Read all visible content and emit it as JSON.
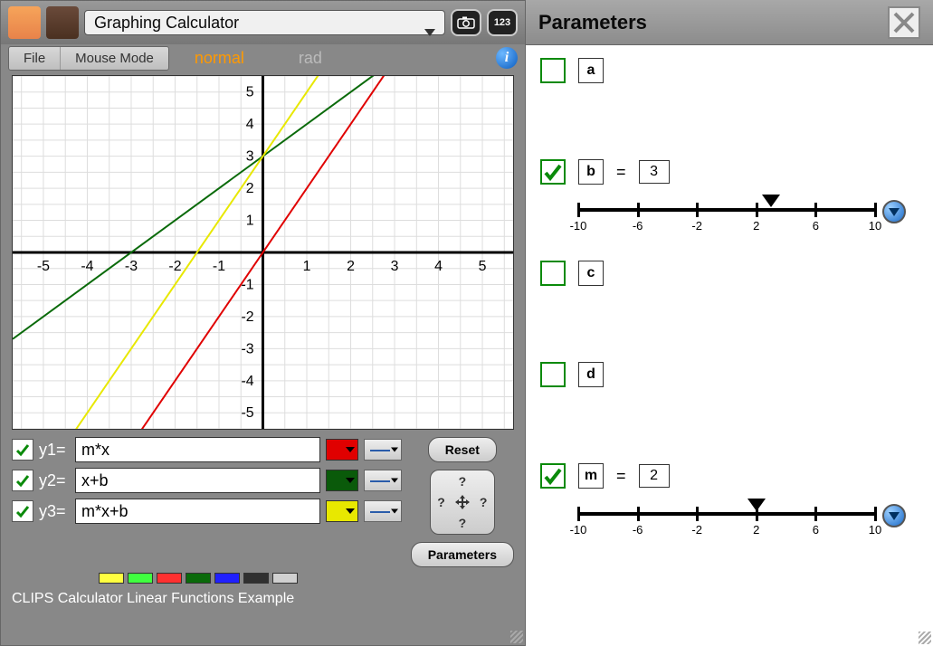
{
  "app_title": "Graphing Calculator",
  "counter_icon_label": "123",
  "menu": {
    "file": "File",
    "mouse_mode": "Mouse Mode"
  },
  "modes": {
    "normal": "normal",
    "rad": "rad"
  },
  "reset_label": "Reset",
  "parameters_btn_label": "Parameters",
  "footer": "CLIPS Calculator Linear Functions Example",
  "equations": [
    {
      "label": "y1=",
      "expr": "m*x",
      "color": "#e00000",
      "checked": true
    },
    {
      "label": "y2=",
      "expr": "x+b",
      "color": "#0a5a0a",
      "checked": true
    },
    {
      "label": "y3=",
      "expr": "m*x+b",
      "color": "#e8e800",
      "checked": true
    }
  ],
  "palette": [
    "#ffff40",
    "#40ff40",
    "#ff3030",
    "#0a6a0a",
    "#2020ff",
    "#303030",
    "#d0d0d0"
  ],
  "chart_data": {
    "type": "line",
    "xlim": [
      -5.7,
      5.7
    ],
    "ylim": [
      -5.5,
      5.5
    ],
    "xticks": [
      -5,
      -4,
      -3,
      -2,
      -1,
      1,
      2,
      3,
      4,
      5
    ],
    "yticks": [
      -5,
      -4,
      -3,
      -2,
      -1,
      1,
      2,
      3,
      4,
      5
    ],
    "grid_step": 0.5,
    "series": [
      {
        "name": "y1 = m*x",
        "color": "#e00000",
        "m": 2,
        "b": 0
      },
      {
        "name": "y2 = x+b",
        "color": "#0a6a0a",
        "m": 1,
        "b": 3
      },
      {
        "name": "y3 = m*x+b",
        "color": "#e8e800",
        "m": 2,
        "b": 3
      }
    ]
  },
  "right_panel": {
    "title": "Parameters",
    "slider_ticks": [
      -10,
      -6,
      -2,
      2,
      6,
      10
    ],
    "slider_range": [
      -10,
      10
    ],
    "params": [
      {
        "name": "a",
        "checked": false,
        "value": null
      },
      {
        "name": "b",
        "checked": true,
        "value": 3
      },
      {
        "name": "c",
        "checked": false,
        "value": null
      },
      {
        "name": "d",
        "checked": false,
        "value": null
      },
      {
        "name": "m",
        "checked": true,
        "value": 2
      }
    ]
  }
}
